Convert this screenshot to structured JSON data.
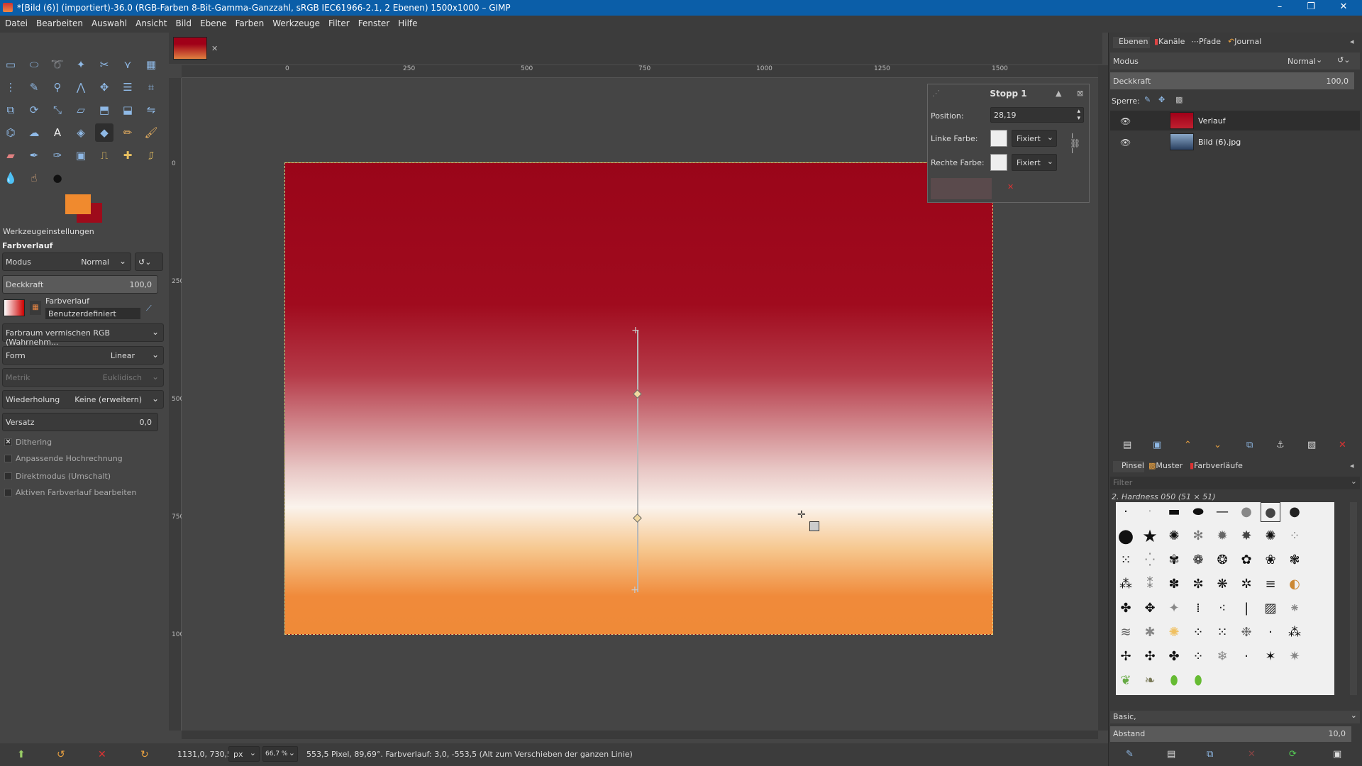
{
  "window": {
    "title": "*[Bild (6)] (importiert)-36.0 (RGB-Farben 8-Bit-Gamma-Ganzzahl, sRGB IEC61966-2.1, 2 Ebenen) 1500x1000 – GIMP",
    "minimize": "–",
    "restore": "❐",
    "close": "✕"
  },
  "menu": [
    "Datei",
    "Bearbeiten",
    "Auswahl",
    "Ansicht",
    "Bild",
    "Ebene",
    "Farben",
    "Werkzeuge",
    "Filter",
    "Fenster",
    "Hilfe"
  ],
  "tool_options": {
    "tab_label": "Werkzeugeinstellungen",
    "tool_name": "Farbverlauf",
    "mode_label": "Modus",
    "mode_value": "Normal",
    "opacity_label": "Deckkraft",
    "opacity_value": "100,0",
    "gradient_name": "Farbverlauf",
    "gradient_sub": "Benutzerdefiniert",
    "colorspace": "Farbraum vermischen RGB (Wahrnehm...",
    "shape_label": "Form",
    "shape_value": "Linear",
    "metric_label": "Metrik",
    "metric_value": "Euklidisch",
    "repeat_label": "Wiederholung",
    "repeat_value": "Keine (erweitern)",
    "offset_label": "Versatz",
    "offset_value": "0,0",
    "dithering": "Dithering",
    "adaptive": "Anpassende Hochrechnung",
    "instant": "Direktmodus (Umschalt)",
    "edit_active": "Aktiven Farbverlauf bearbeiten"
  },
  "ruler": {
    "h_ticks": [
      "0",
      "250",
      "500",
      "750",
      "1000",
      "1250",
      "1500"
    ],
    "v_ticks": [
      "0",
      "250",
      "500",
      "750",
      "1000"
    ]
  },
  "stop_dialog": {
    "title": "Stopp 1",
    "position_label": "Position:",
    "position_value": "28,19",
    "left_label": "Linke Farbe:",
    "left_mode": "Fixiert",
    "right_label": "Rechte Farbe:",
    "right_mode": "Fixiert"
  },
  "status": {
    "coords": "1131,0, 730,5",
    "unit": "px",
    "zoom": "66,7 %",
    "message": "553,5 Pixel, 89,69°. Farbverlauf: 3,0, -553,5 (Alt zum Verschieben der ganzen Linie)"
  },
  "layers_panel": {
    "tabs": [
      "Ebenen",
      "Kanäle",
      "Pfade",
      "Journal"
    ],
    "mode_label": "Modus",
    "mode_value": "Normal",
    "opacity_label": "Deckkraft",
    "opacity_value": "100,0",
    "lock_label": "Sperre:",
    "layers": [
      {
        "name": "Verlauf"
      },
      {
        "name": "Bild (6).jpg"
      }
    ]
  },
  "brushes_panel": {
    "tabs": [
      "Pinsel",
      "Muster",
      "Farbverläufe"
    ],
    "filter_placeholder": "Filter",
    "brush_name": "2. Hardness 050 (51 × 51)",
    "preset": "Basic,",
    "spacing_label": "Abstand",
    "spacing_value": "10,0"
  },
  "colors": {
    "foreground": "#f08a2e",
    "background": "#9e0b1b",
    "title_bar": "#0b5ea8"
  }
}
